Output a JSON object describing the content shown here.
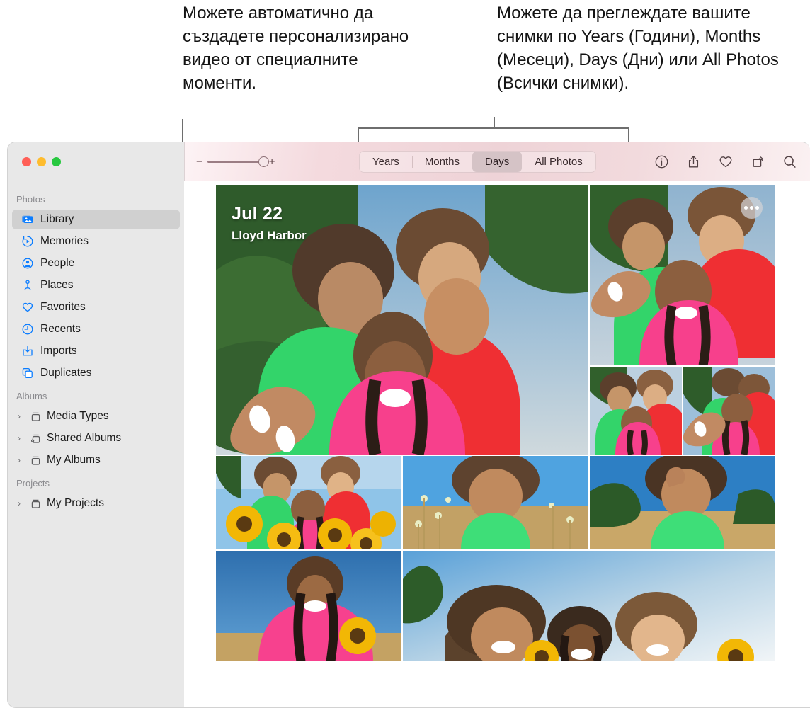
{
  "callouts": {
    "left": "Можете автоматично да създадете персонализирано видео от специалните моменти.",
    "right": "Можете да преглеждате вашите снимки по Years (Години), Months (Месеци), Days (Дни) или All Photos (Всички снимки)."
  },
  "window": {
    "traffic_lights": [
      {
        "name": "close",
        "color": "#FF5F57"
      },
      {
        "name": "minimize",
        "color": "#FEBC2E"
      },
      {
        "name": "zoom",
        "color": "#28C840"
      }
    ]
  },
  "toolbar": {
    "zoom_slider": {
      "minus": "−",
      "plus": "+",
      "value": 86
    },
    "segments": [
      {
        "label": "Years",
        "selected": false
      },
      {
        "label": "Months",
        "selected": false
      },
      {
        "label": "Days",
        "selected": true
      },
      {
        "label": "All Photos",
        "selected": false
      }
    ],
    "icons": [
      {
        "name": "info-icon",
        "title": "Info"
      },
      {
        "name": "share-icon",
        "title": "Share"
      },
      {
        "name": "heart-icon",
        "title": "Favorite"
      },
      {
        "name": "rotate-icon",
        "title": "Rotate"
      },
      {
        "name": "search-icon",
        "title": "Search"
      }
    ]
  },
  "sidebar": {
    "sections": [
      {
        "title": "Photos",
        "items": [
          {
            "label": "Library",
            "icon": "library-icon",
            "selected": true,
            "expandable": false
          },
          {
            "label": "Memories",
            "icon": "memories-icon",
            "selected": false,
            "expandable": false
          },
          {
            "label": "People",
            "icon": "people-icon",
            "selected": false,
            "expandable": false
          },
          {
            "label": "Places",
            "icon": "places-icon",
            "selected": false,
            "expandable": false
          },
          {
            "label": "Favorites",
            "icon": "favorites-icon",
            "selected": false,
            "expandable": false
          },
          {
            "label": "Recents",
            "icon": "recents-icon",
            "selected": false,
            "expandable": false
          },
          {
            "label": "Imports",
            "icon": "imports-icon",
            "selected": false,
            "expandable": false
          },
          {
            "label": "Duplicates",
            "icon": "duplicates-icon",
            "selected": false,
            "expandable": false
          }
        ]
      },
      {
        "title": "Albums",
        "items": [
          {
            "label": "Media Types",
            "icon": "album-icon",
            "selected": false,
            "expandable": true
          },
          {
            "label": "Shared Albums",
            "icon": "shared-album-icon",
            "selected": false,
            "expandable": true
          },
          {
            "label": "My Albums",
            "icon": "album-icon",
            "selected": false,
            "expandable": true
          }
        ]
      },
      {
        "title": "Projects",
        "items": [
          {
            "label": "My Projects",
            "icon": "album-icon",
            "selected": false,
            "expandable": true
          }
        ]
      }
    ],
    "chevron": "›"
  },
  "main": {
    "day_header": {
      "date": "Jul 22",
      "location": "Lloyd Harbor"
    },
    "more_button_label": "•••"
  }
}
